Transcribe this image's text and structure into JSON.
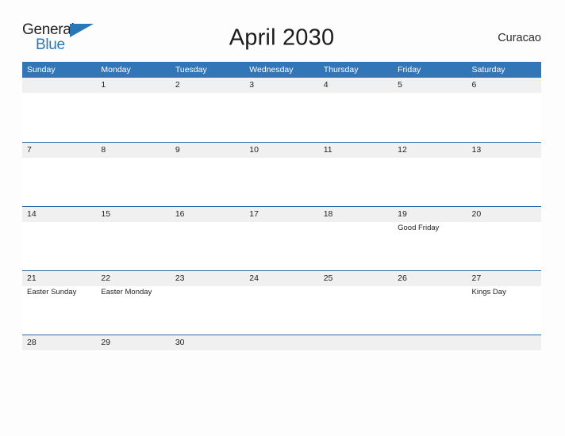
{
  "brand": {
    "name_part1": "General",
    "name_part2": "Blue",
    "flag_icon": "blue-triangle-flag"
  },
  "header": {
    "title": "April 2030",
    "region": "Curacao"
  },
  "calendar": {
    "month": "April",
    "year": "2030",
    "weekday_headers": [
      "Sunday",
      "Monday",
      "Tuesday",
      "Wednesday",
      "Thursday",
      "Friday",
      "Saturday"
    ],
    "colors": {
      "header_blue": "#3276b8",
      "divider_blue": "#2a6ca8",
      "date_band_gray": "#f0f0f0",
      "brand_blue": "#2a77b8",
      "text_dark": "#231f20"
    },
    "weeks": [
      [
        {
          "day": "",
          "event": ""
        },
        {
          "day": "1",
          "event": ""
        },
        {
          "day": "2",
          "event": ""
        },
        {
          "day": "3",
          "event": ""
        },
        {
          "day": "4",
          "event": ""
        },
        {
          "day": "5",
          "event": ""
        },
        {
          "day": "6",
          "event": ""
        }
      ],
      [
        {
          "day": "7",
          "event": ""
        },
        {
          "day": "8",
          "event": ""
        },
        {
          "day": "9",
          "event": ""
        },
        {
          "day": "10",
          "event": ""
        },
        {
          "day": "11",
          "event": ""
        },
        {
          "day": "12",
          "event": ""
        },
        {
          "day": "13",
          "event": ""
        }
      ],
      [
        {
          "day": "14",
          "event": ""
        },
        {
          "day": "15",
          "event": ""
        },
        {
          "day": "16",
          "event": ""
        },
        {
          "day": "17",
          "event": ""
        },
        {
          "day": "18",
          "event": ""
        },
        {
          "day": "19",
          "event": "Good Friday"
        },
        {
          "day": "20",
          "event": ""
        }
      ],
      [
        {
          "day": "21",
          "event": "Easter Sunday"
        },
        {
          "day": "22",
          "event": "Easter Monday"
        },
        {
          "day": "23",
          "event": ""
        },
        {
          "day": "24",
          "event": ""
        },
        {
          "day": "25",
          "event": ""
        },
        {
          "day": "26",
          "event": ""
        },
        {
          "day": "27",
          "event": "Kings Day"
        }
      ],
      [
        {
          "day": "28",
          "event": ""
        },
        {
          "day": "29",
          "event": ""
        },
        {
          "day": "30",
          "event": ""
        },
        {
          "day": "",
          "event": ""
        },
        {
          "day": "",
          "event": ""
        },
        {
          "day": "",
          "event": ""
        },
        {
          "day": "",
          "event": ""
        }
      ]
    ]
  }
}
